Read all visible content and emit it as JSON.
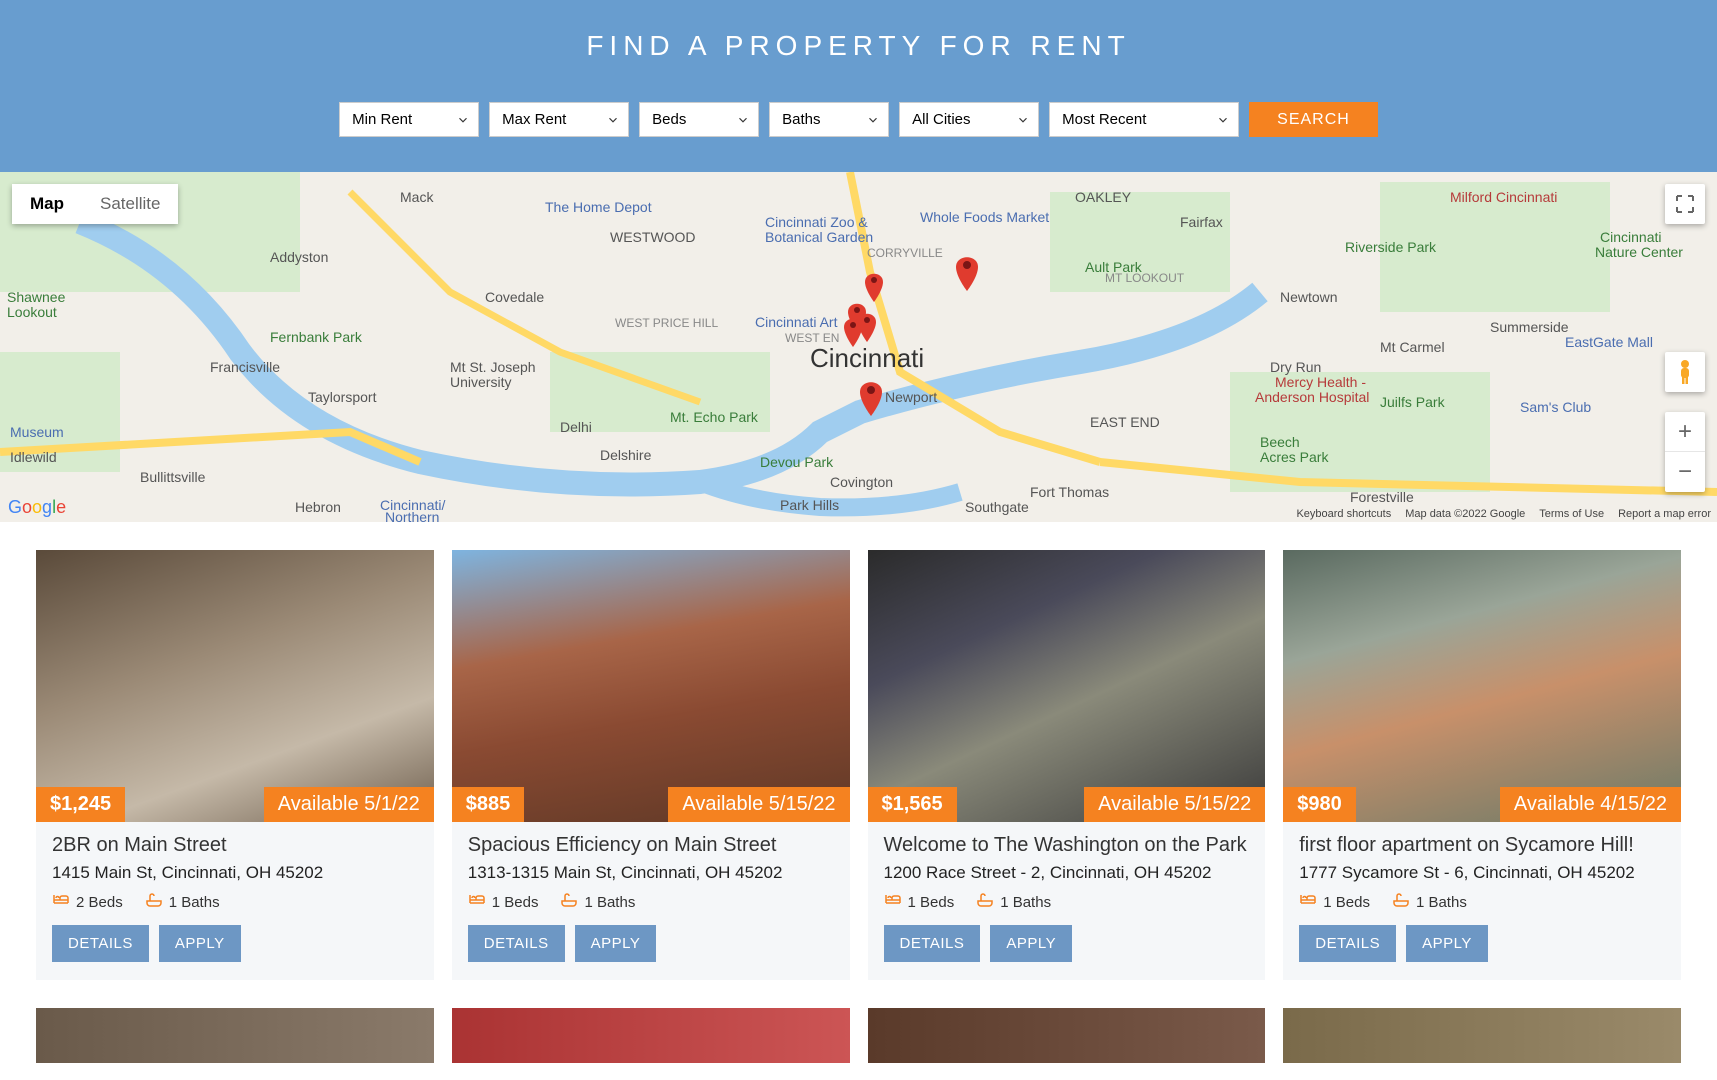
{
  "header": {
    "title": "FIND A PROPERTY FOR RENT",
    "selects": {
      "min_rent": "Min Rent",
      "max_rent": "Max Rent",
      "beds": "Beds",
      "baths": "Baths",
      "cities": "All Cities",
      "sort": "Most Recent"
    },
    "search_label": "SEARCH"
  },
  "map": {
    "type_map": "Map",
    "type_satellite": "Satellite",
    "city_label": "Cincinnati",
    "attribution": {
      "shortcuts": "Keyboard shortcuts",
      "data": "Map data ©2022 Google",
      "terms": "Terms of Use",
      "report": "Report a map error"
    },
    "places": [
      "The Home Depot",
      "Cincinnati Zoo & Botanical Garden",
      "Whole Foods Market",
      "Ault Park",
      "Riverside Park",
      "Cincinnati Nature Center",
      "EastGate Mall",
      "Sam's Club",
      "Mercy Health - Anderson Hospital",
      "Juilfs Park",
      "Beech Acres Park",
      "Forestville",
      "Newtown",
      "Mt Carmel",
      "Summerside",
      "Dry Run",
      "Fairfax",
      "MT LOOKOUT",
      "Fort Thomas",
      "Southgate",
      "Newport",
      "Covington",
      "Devou Park",
      "Park Hills",
      "Mt. Echo Park",
      "Delshire",
      "Delhi",
      "Mt St. Joseph University",
      "Covedale",
      "Westwood",
      "Mack",
      "Addyston",
      "Francisville",
      "Taylorsport",
      "Bullittsville",
      "Idlewild",
      "Hebron",
      "Museum",
      "Shawnee Lookout",
      "Fernbank Park",
      "Cincinnati/Northern",
      "Cincinnati Art",
      "CORRYVILLE",
      "OAKLEY",
      "EAST END",
      "Milford Cincinnati",
      "WEST PRICE HILL",
      "WEST EN"
    ]
  },
  "cards": [
    {
      "price": "$1,245",
      "avail": "Available 5/1/22",
      "title": "2BR on Main Street",
      "addr": "1415 Main St, Cincinnati, OH 45202",
      "beds": "2 Beds",
      "baths": "1 Baths",
      "bg": "linear-gradient(160deg,#5a4a3a 0%,#9b8a76 40%,#c5b9a8 70%,#6e5e4d 100%)"
    },
    {
      "price": "$885",
      "avail": "Available 5/15/22",
      "title": "Spacious Efficiency on Main Street",
      "addr": "1313-1315 Main St, Cincinnati, OH 45202",
      "beds": "1 Beds",
      "baths": "1 Baths",
      "bg": "linear-gradient(170deg,#7eb4e0 0%,#a86548 35%,#8a4a32 60%,#5e3826 100%)"
    },
    {
      "price": "$1,565",
      "avail": "Available 5/15/22",
      "title": "Welcome to The Washington on the Park",
      "addr": "1200 Race Street - 2, Cincinnati, OH 45202",
      "beds": "1 Beds",
      "baths": "1 Baths",
      "bg": "linear-gradient(155deg,#2b2b2b 0%,#4a4a5a 30%,#8a8a7a 55%,#3a3a3a 100%)"
    },
    {
      "price": "$980",
      "avail": "Available 4/15/22",
      "title": "first floor apartment on Sycamore Hill!",
      "addr": "1777 Sycamore St - 6, Cincinnati, OH 45202",
      "beds": "1 Beds",
      "baths": "1 Baths",
      "bg": "linear-gradient(165deg,#5a6a60 0%,#9aa598 30%,#c8906a 55%,#6a7a68 100%)"
    }
  ],
  "buttons": {
    "details": "DETAILS",
    "apply": "APPLY"
  },
  "partial_bgs": [
    "linear-gradient(90deg,#6a5a4a,#8a7a6a)",
    "linear-gradient(90deg,#aa3333,#cc5555)",
    "linear-gradient(90deg,#5a3a2a,#7a5a4a)",
    "linear-gradient(90deg,#7a6a4a,#9a8a6a)"
  ]
}
